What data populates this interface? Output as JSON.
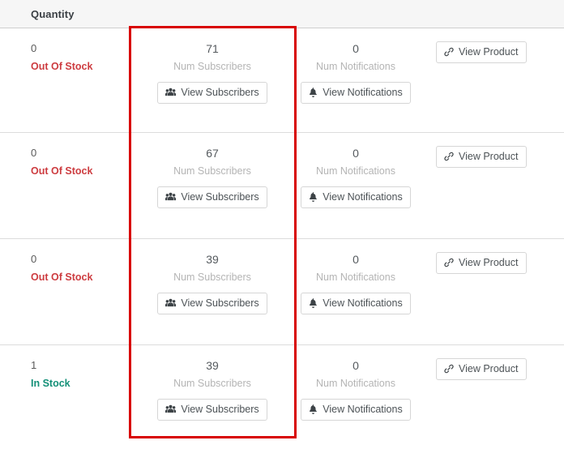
{
  "header": {
    "quantity_label": "Quantity"
  },
  "icons": {
    "subscribers": "users-icon",
    "notifications": "bell-icon",
    "product": "link-icon"
  },
  "labels": {
    "num_subscribers": "Num Subscribers",
    "num_notifications": "Num Notifications",
    "view_subscribers": "View Subscribers",
    "view_notifications": "View Notifications",
    "view_product": "View Product"
  },
  "colors": {
    "out_of_stock": "#cd3c40",
    "in_stock": "#149078",
    "highlight": "#d80000",
    "header_bg": "#f6f6f6",
    "row_border": "#dcdcdc"
  },
  "highlight": {
    "target_column": "Num Subscribers",
    "color": "#d80000"
  },
  "rows": [
    {
      "quantity": "0",
      "stock_status": "Out Of Stock",
      "stock_state": "out",
      "num_subscribers": "71",
      "num_notifications": "0"
    },
    {
      "quantity": "0",
      "stock_status": "Out Of Stock",
      "stock_state": "out",
      "num_subscribers": "67",
      "num_notifications": "0"
    },
    {
      "quantity": "0",
      "stock_status": "Out Of Stock",
      "stock_state": "out",
      "num_subscribers": "39",
      "num_notifications": "0"
    },
    {
      "quantity": "1",
      "stock_status": "In Stock",
      "stock_state": "in",
      "num_subscribers": "39",
      "num_notifications": "0"
    }
  ]
}
